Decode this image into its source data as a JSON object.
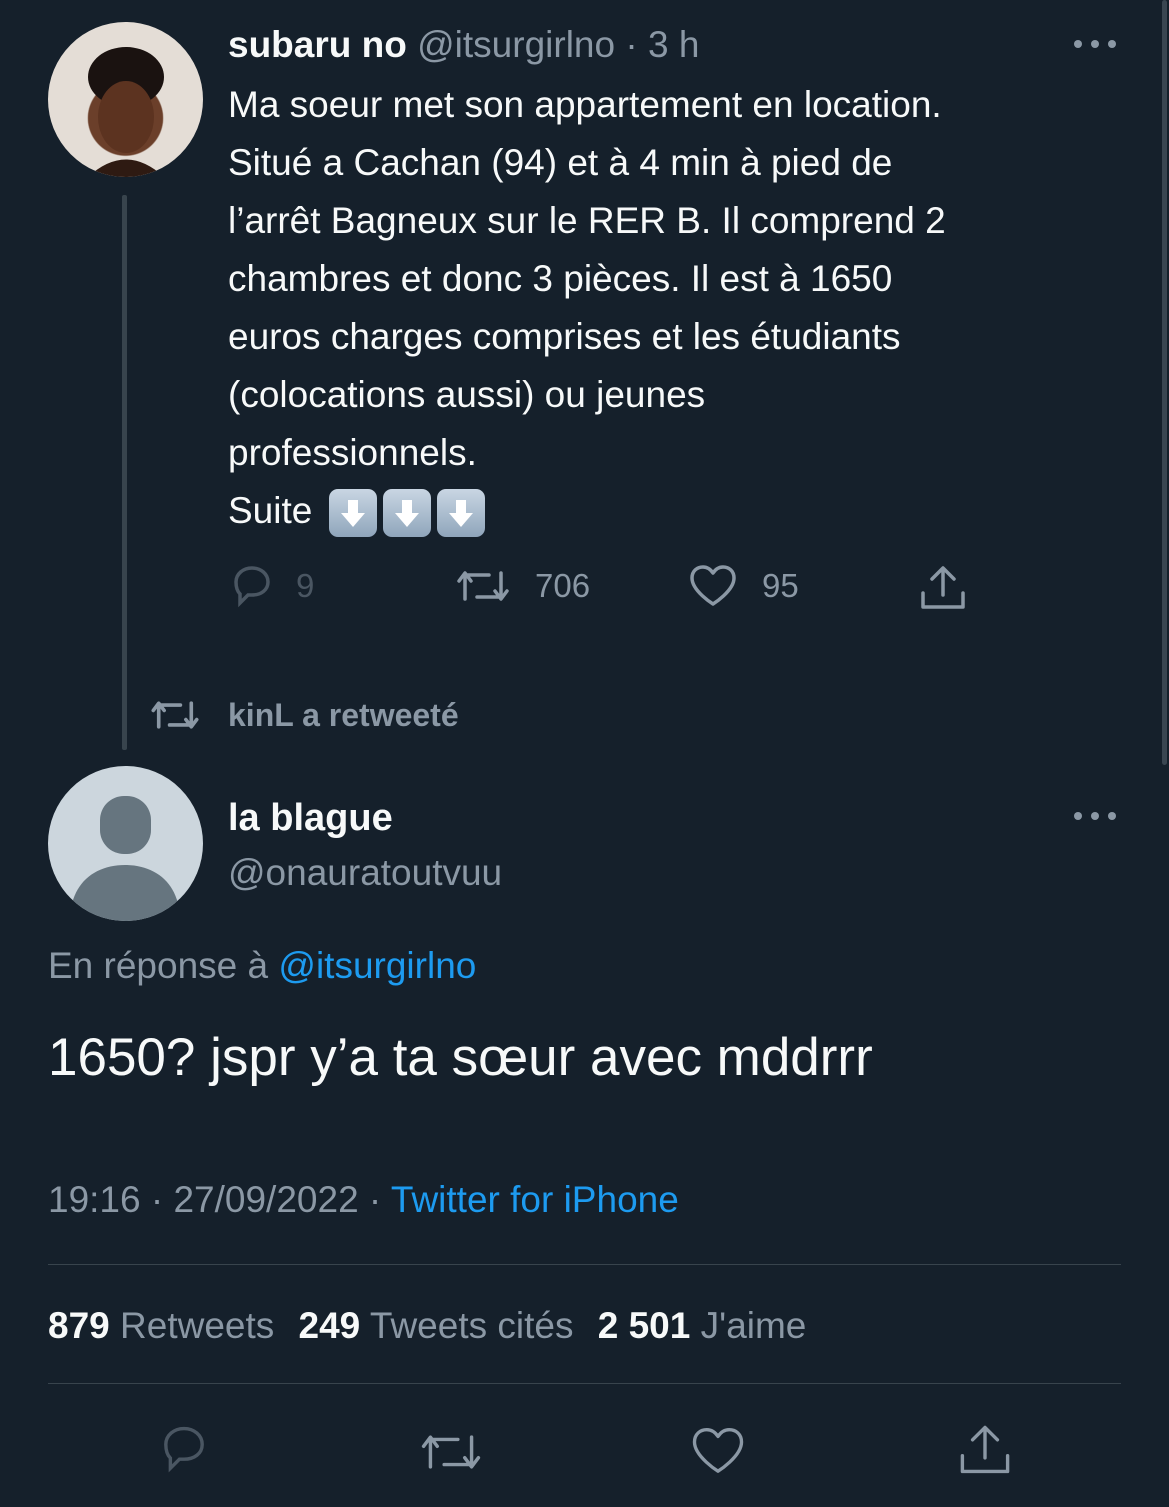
{
  "original_tweet": {
    "display_name": "subaru no",
    "handle": "@itsurgirlno",
    "time": "· 3 h",
    "lines": [
      "Ma soeur met son appartement en location.",
      "Situé a Cachan (94) et à 4 min à pied de",
      "l’arrêt Bagneux sur le RER B. Il comprend 2",
      "chambres et donc 3 pièces. Il est à 1650",
      "euros charges comprises et les étudiants",
      "(colocations aussi) ou jeunes",
      "professionnels."
    ],
    "suite_label": "Suite",
    "suite_icons": [
      "down-arrow-emoji",
      "down-arrow-emoji",
      "down-arrow-emoji"
    ],
    "replies": "9",
    "retweets": "706",
    "likes": "95"
  },
  "retweet_notice": "kinL a retweeté",
  "main_tweet": {
    "display_name": "la blague",
    "handle": "@onauratoutvuu",
    "reply_prefix": "En réponse à",
    "reply_to": "@itsurgirlno",
    "text": "1650? jspr y’a ta sœur avec mddrrr",
    "timestamp": "19:16 · 27/09/2022 ·",
    "source": "Twitter for iPhone"
  },
  "stats": {
    "retweets_count": "879",
    "retweets_label": "Retweets",
    "quotes_count": "249",
    "quotes_label": "Tweets cités",
    "likes_count": "2 501",
    "likes_label": "J'aime"
  },
  "colors": {
    "background": "#15202b",
    "muted": "#8b98a5",
    "link": "#1d9bf0",
    "divider": "#38444d"
  }
}
